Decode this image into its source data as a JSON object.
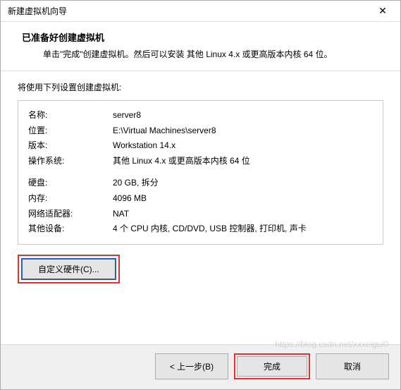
{
  "window": {
    "title": "新建虚拟机向导",
    "close_icon": "✕"
  },
  "header": {
    "title": "已准备好创建虚拟机",
    "description": "单击\"完成\"创建虚拟机。然后可以安装 其他 Linux 4.x 或更高版本内核 64 位。"
  },
  "subtitle": "将使用下列设置创建虚拟机:",
  "summary": {
    "name_label": "名称:",
    "name_value": "server8",
    "location_label": "位置:",
    "location_value": "E:\\Virtual Machines\\server8",
    "version_label": "版本:",
    "version_value": "Workstation 14.x",
    "os_label": "操作系统:",
    "os_value": "其他 Linux 4.x 或更高版本内核 64 位",
    "disk_label": "硬盘:",
    "disk_value": "20 GB, 拆分",
    "memory_label": "内存:",
    "memory_value": "4096 MB",
    "network_label": "网络适配器:",
    "network_value": "NAT",
    "other_label": "其他设备:",
    "other_value": "4 个 CPU 内核, CD/DVD, USB 控制器, 打印机, 声卡"
  },
  "buttons": {
    "customize": "自定义硬件(C)...",
    "back": "< 上一步(B)",
    "finish": "完成",
    "cancel": "取消"
  },
  "watermark": "https://blog.csdn.net/xxxeigui0"
}
